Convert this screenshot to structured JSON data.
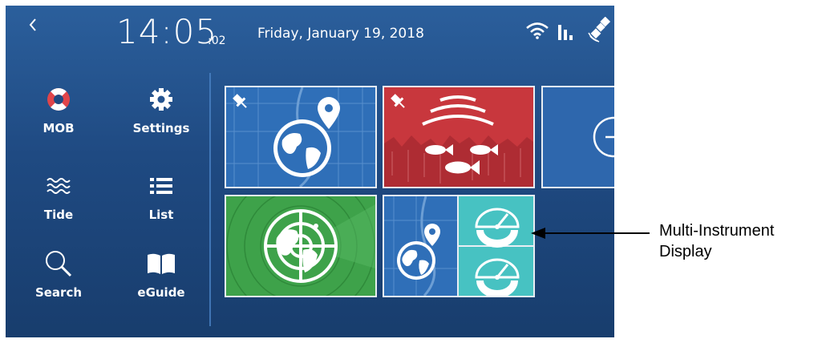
{
  "header": {
    "time": "14:05",
    "seconds": ":02",
    "date": "Friday, January 19, 2018",
    "back_icon": "chevron-left-icon",
    "status_icons": [
      "wifi-icon",
      "signal-bars-icon",
      "satellite-icon"
    ]
  },
  "sidebar": {
    "items": [
      {
        "label": "MOB",
        "icon": "life-ring-icon"
      },
      {
        "label": "Settings",
        "icon": "gear-icon"
      },
      {
        "label": "Tide",
        "icon": "waves-icon"
      },
      {
        "label": "List",
        "icon": "list-icon"
      },
      {
        "label": "Search",
        "icon": "magnifier-icon"
      },
      {
        "label": "eGuide",
        "icon": "book-icon"
      }
    ]
  },
  "tiles": [
    {
      "name": "chart-app-tile",
      "icon": "globe-pin-icon",
      "pinned": true,
      "color": "#2f6fb8"
    },
    {
      "name": "sonar-app-tile",
      "icon": "fish-sonar-icon",
      "pinned": true,
      "color": "#c8373d"
    },
    {
      "name": "add-app-tile",
      "icon": "plus-circle-icon",
      "color": "#2e67ad"
    },
    {
      "name": "radar-app-tile",
      "icon": "radar-globe-icon",
      "color": "#3ea24a"
    },
    {
      "name": "multi-instrument-tile",
      "icon": "globe-gauge-icon",
      "color": "#47c2c2"
    }
  ],
  "annotation": {
    "line1": "Multi-Instrument",
    "line2": "Display"
  },
  "colors": {
    "background_top": "#2b5f9c",
    "background_bottom": "#183d6d",
    "chart_blue": "#2f6fb8",
    "sonar_red": "#c8373d",
    "radar_green": "#3ea24a",
    "instrument_cyan": "#47c2c2",
    "mob_red": "#e0454a"
  }
}
